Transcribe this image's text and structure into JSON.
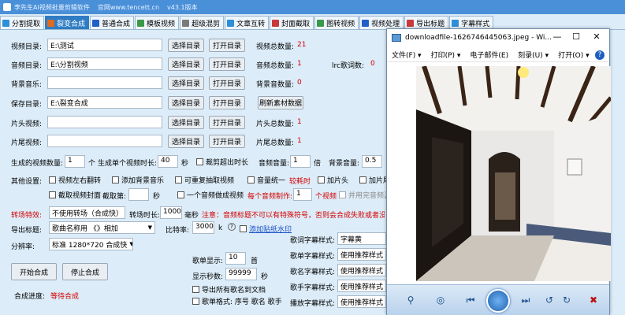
{
  "titlebar": {
    "app": "李先生AI视频批量剪辑软件",
    "site": "官网www.tencett.cn",
    "version": "v43.1版本"
  },
  "tabs": [
    {
      "label": "分割提取",
      "color": "#2c8fd8"
    },
    {
      "label": "裂变合成",
      "color": "#e06b1f"
    },
    {
      "label": "普通合成",
      "color": "#2060c8"
    },
    {
      "label": "模板视频",
      "color": "#3a9a4a"
    },
    {
      "label": "超级混剪",
      "color": "#7a7a7a"
    },
    {
      "label": "文章互转",
      "color": "#2c8fd8"
    },
    {
      "label": "封面截取",
      "color": "#c83a3a"
    },
    {
      "label": "图转视频",
      "color": "#3a9a4a"
    },
    {
      "label": "视频处理",
      "color": "#2060c8"
    },
    {
      "label": "导出标题",
      "color": "#c83a3a"
    },
    {
      "label": "字幕样式",
      "color": "#2c8fd8"
    }
  ],
  "form": {
    "video_dir_label": "视频目录:",
    "video_dir": "E:\\测试",
    "audio_dir_label": "音频目录:",
    "audio_dir": "E:\\分割视频",
    "bgm_label": "背景音乐:",
    "bgm": "",
    "save_dir_label": "保存目录:",
    "save_dir": "E:\\裂变合成",
    "intro_label": "片头视频:",
    "intro": "",
    "outro_label": "片尾视频:",
    "outro": "",
    "choose_dir": "选择目录",
    "open_dir": "打开目录",
    "refresh": "刷新素材数据",
    "video_total_label": "视频总数量:",
    "video_total": "21",
    "audio_total_label": "音频总数量:",
    "audio_total": "1",
    "lrc_total_label": "lrc歌词数:",
    "lrc_total": "0",
    "bgm_total_label": "背景音数量:",
    "bgm_total": "0",
    "intro_total_label": "片头总数量:",
    "intro_total": "1",
    "outro_total_label": "片尾总数量:",
    "outro_total": "1"
  },
  "gen": {
    "count_label": "生成的视频数量:",
    "count": "1",
    "unit_ge": "个",
    "dur_label": "生成单个视频时长:",
    "dur": "40",
    "unit_s": "秒",
    "cut_over": "裁剪超出时长",
    "vol_label": "音频音量:",
    "vol": "1",
    "unit_bei": "倍",
    "bgvol_label": "背景音量:",
    "bgvol": "0.5"
  },
  "other": {
    "label": "其他设置:",
    "flip": "视频左右翻转",
    "add_bgm": "添加背景音乐",
    "repeat": "可重复抽取视频",
    "unify": "音量统一",
    "unify_note": "较耗时",
    "add_intro": "加片头",
    "add_outro": "加片尾",
    "capture_cover": "截取视频封面",
    "frame_label": "截取第:",
    "frame": "",
    "unit_s": "秒",
    "one_audio": "一个音频做成视频",
    "per_audio_label": "每个音频制作:",
    "per_audio": "1",
    "per_audio_unit": "个视频",
    "keep_audio": "并用完音频源"
  },
  "transition": {
    "label": "转场特效:",
    "mode": "不使用转场（合成快）",
    "len_label": "转场时长:",
    "len": "1000",
    "unit_ms": "毫秒",
    "note": "注意：音频标题不可以有特殊符号，否则会合成失败或者没有声"
  },
  "export": {
    "label": "导出标题:",
    "mode": "歌曲名称用 《》相加",
    "bitrate_label": "比特率:",
    "bitrate": "3000",
    "unit_k": "k",
    "watermark": "添加贴纸水印"
  },
  "resolution": {
    "label": "分辨率:",
    "value": "标准 1280*720 合成快"
  },
  "lyrics": {
    "display_label": "歌单显示:",
    "display": "10",
    "display_unit": "首",
    "seconds_label": "显示秒数:",
    "seconds": "99999",
    "seconds_unit": "秒",
    "export_names": "导出所有歌名到文档",
    "format_label": "歌单格式: 序号 歌名 歌手",
    "styles": [
      {
        "label": "歌词字幕样式:",
        "value": "字幕黄"
      },
      {
        "label": "歌单字幕样式:",
        "value": "使用推荐样式"
      },
      {
        "label": "歌名字幕样式:",
        "value": "使用推荐样式"
      },
      {
        "label": "歌手字幕样式:",
        "value": "使用推荐样式"
      },
      {
        "label": "播放字幕样式:",
        "value": "使用推荐样式"
      }
    ]
  },
  "actions": {
    "start": "开始合成",
    "stop": "停止合成",
    "progress_label": "合成进度:",
    "progress": "等待合成"
  },
  "viewer": {
    "title": "downloadfile-1626746445063.jpeg - Wi...",
    "minimize": "—",
    "maximize": "☐",
    "close": "✕",
    "menu": [
      "文件(F) ▾",
      "打印(P) ▾",
      "电子邮件(E)",
      "刻录(U) ▾",
      "打开(O) ▾"
    ],
    "help": "?"
  }
}
